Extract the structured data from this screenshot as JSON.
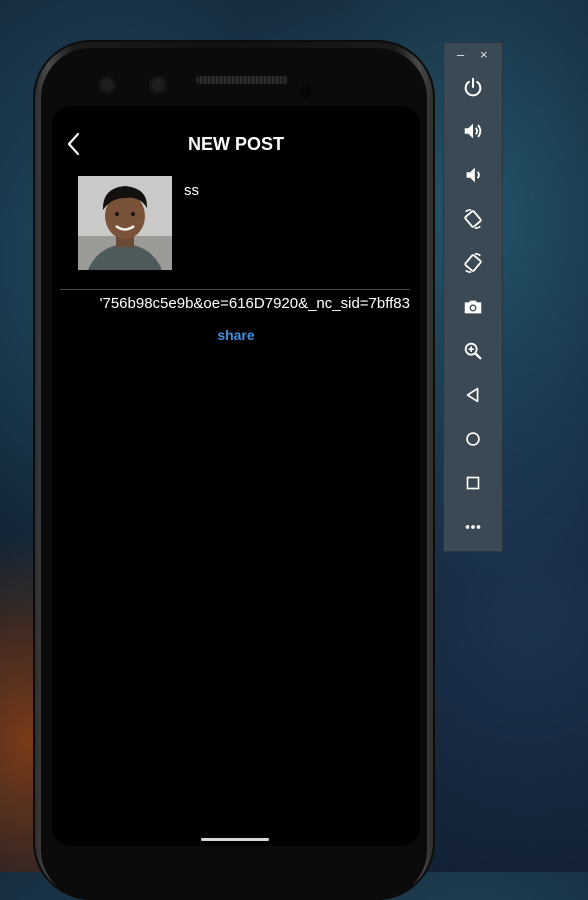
{
  "post": {
    "title": "NEW POST",
    "caption": "ss",
    "url_text": "'756b98c5e9b&oe=616D7920&_nc_sid=7bff83",
    "share_label": "share"
  },
  "toolbar": {
    "minimize": "–",
    "close": "×",
    "items": [
      {
        "icon": "power-icon"
      },
      {
        "icon": "volume-up-icon"
      },
      {
        "icon": "volume-down-icon"
      },
      {
        "icon": "rotate-left-icon"
      },
      {
        "icon": "rotate-right-icon"
      },
      {
        "icon": "camera-icon"
      },
      {
        "icon": "zoom-icon"
      },
      {
        "icon": "back-triangle-icon"
      },
      {
        "icon": "home-circle-icon"
      },
      {
        "icon": "overview-square-icon"
      },
      {
        "icon": "more-icon"
      }
    ]
  },
  "colors": {
    "accent": "#3b8fdc",
    "screen_bg": "#000000",
    "toolbar_bg": "#3a4953"
  }
}
